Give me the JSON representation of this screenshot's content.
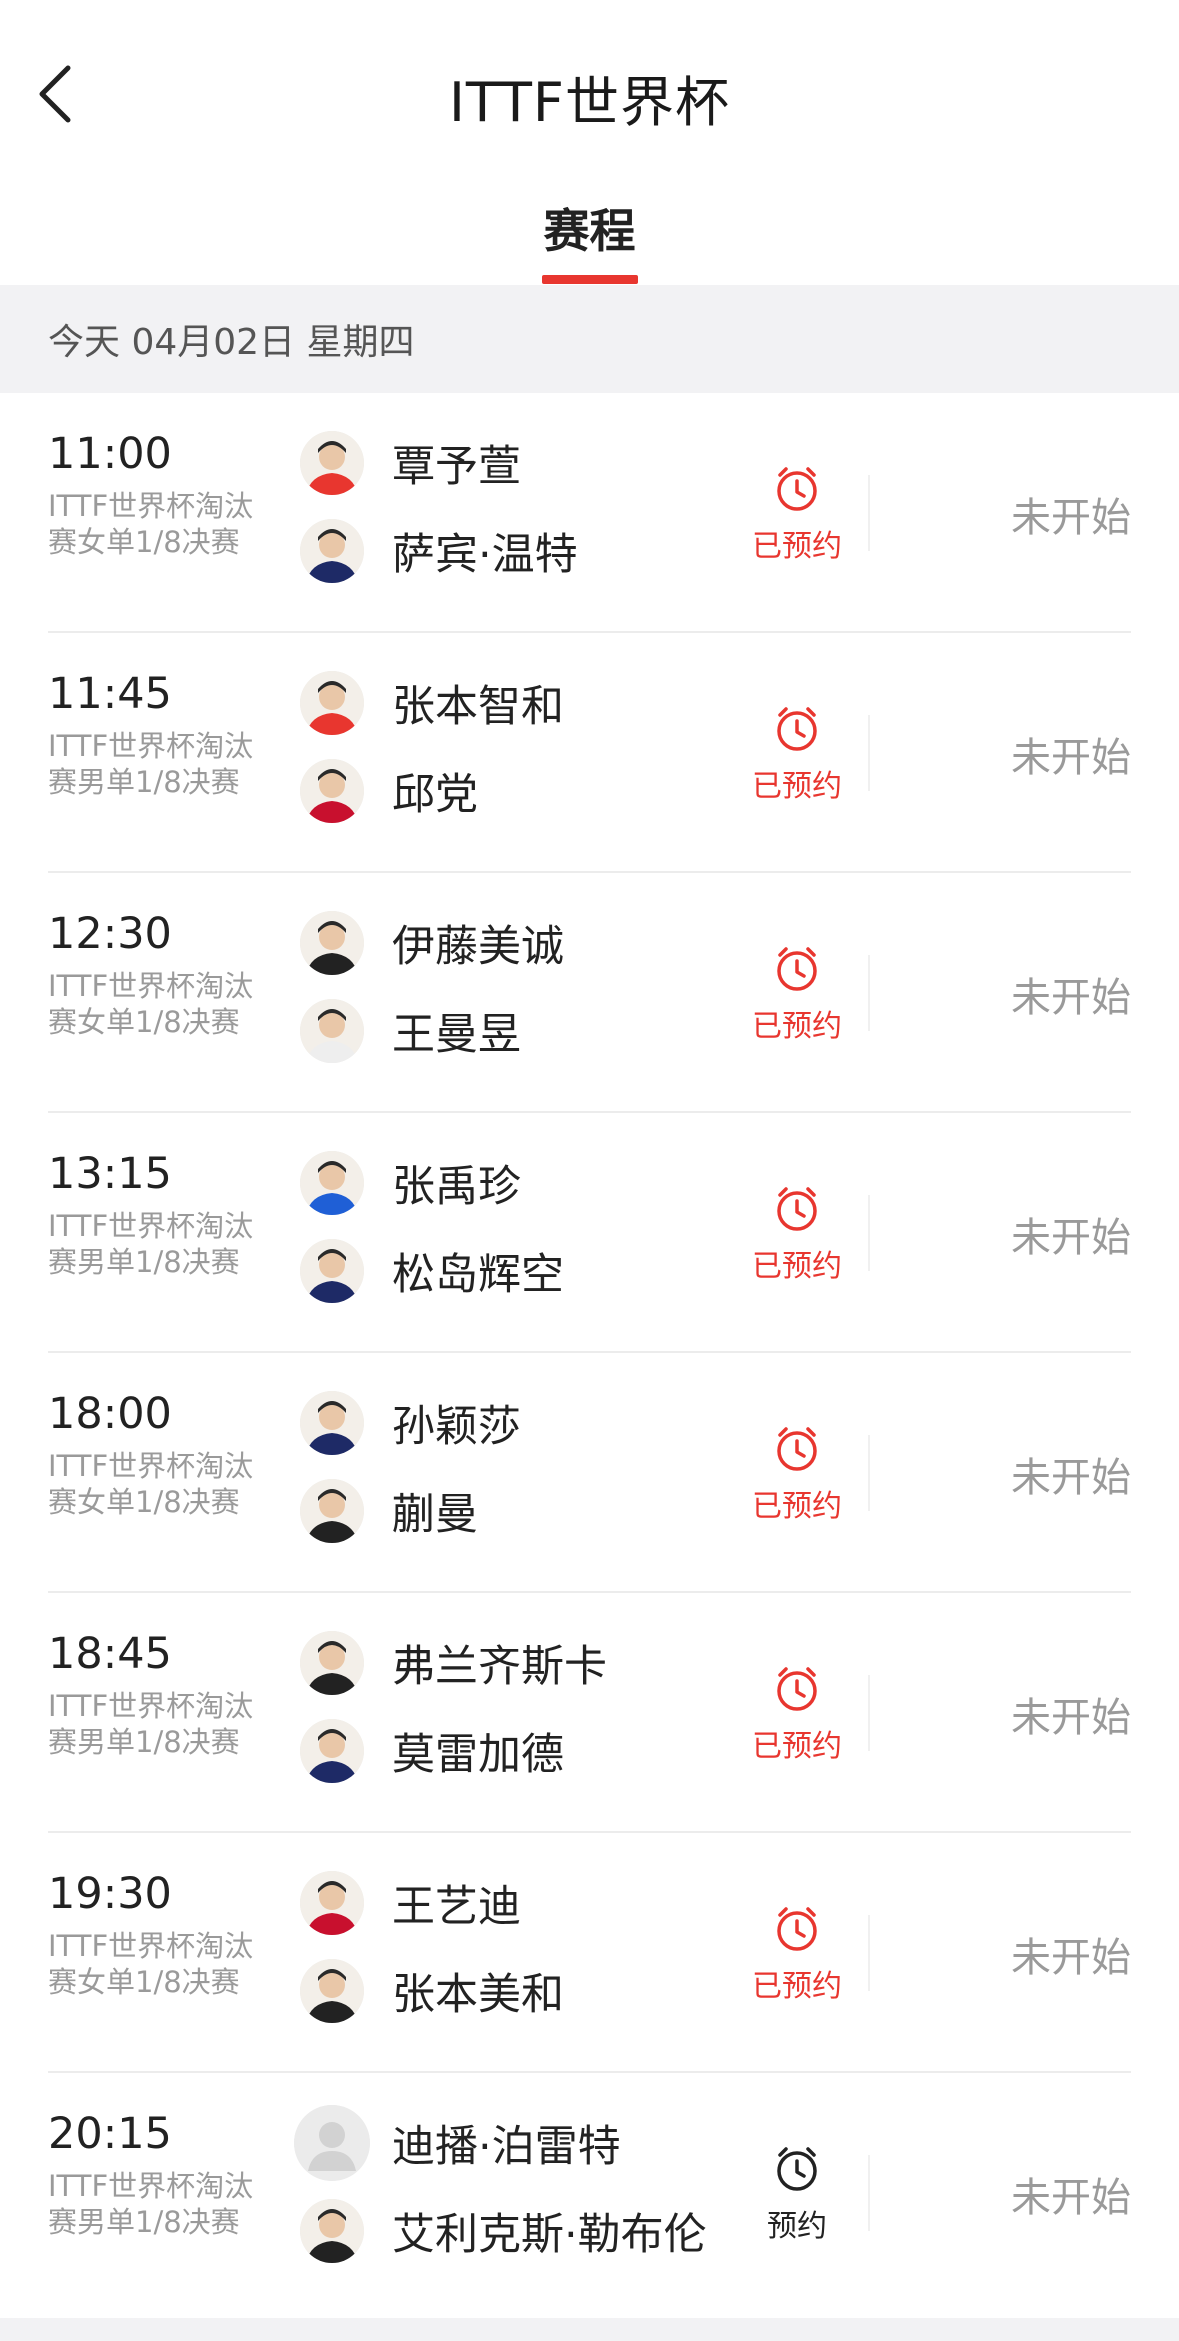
{
  "header": {
    "title": "ITTF世界杯"
  },
  "tabs": [
    {
      "label": "赛程"
    }
  ],
  "date_bar": {
    "text": "今天 04月02日 星期四"
  },
  "matches": [
    {
      "time": "11:00",
      "desc": "ITTF世界杯淘汰赛女单1/8决赛",
      "player1": "覃予萱",
      "player2": "萨宾·温特",
      "reserve": "已预约",
      "status": "未开始"
    },
    {
      "time": "11:45",
      "desc": "ITTF世界杯淘汰赛男单1/8决赛",
      "player1": "张本智和",
      "player2": "邱党",
      "reserve": "已预约",
      "status": "未开始"
    },
    {
      "time": "12:30",
      "desc": "ITTF世界杯淘汰赛女单1/8决赛",
      "player1": "伊藤美诚",
      "player2": "王曼昱",
      "reserve": "已预约",
      "status": "未开始"
    },
    {
      "time": "13:15",
      "desc": "ITTF世界杯淘汰赛男单1/8决赛",
      "player1": "张禹珍",
      "player2": "松岛辉空",
      "reserve": "已预约",
      "status": "未开始"
    },
    {
      "time": "18:00",
      "desc": "ITTF世界杯淘汰赛女单1/8决赛",
      "player1": "孙颖莎",
      "player2": "蒯曼",
      "reserve": "已预约",
      "status": "未开始"
    },
    {
      "time": "18:45",
      "desc": "ITTF世界杯淘汰赛男单1/8决赛",
      "player1": "弗兰齐斯卡",
      "player2": "莫雷加德",
      "reserve": "已预约",
      "status": "未开始"
    },
    {
      "time": "19:30",
      "desc": "ITTF世界杯淘汰赛女单1/8决赛",
      "player1": "王艺迪",
      "player2": "张本美和",
      "reserve": "已预约",
      "status": "未开始"
    },
    {
      "time": "20:15",
      "desc": "ITTF世界杯淘汰赛男单1/8决赛",
      "player1": "迪播·泊雷特",
      "player2": "艾利克斯·勒布伦",
      "reserve": "预约",
      "status": "未开始"
    }
  ],
  "colors": {
    "accent": "#e8362f",
    "muted": "#9a9a9a",
    "date_bar_bg": "#f2f2f4"
  },
  "icons": {
    "back": "chevron-left-icon",
    "alarm": "alarm-clock-icon",
    "avatar_placeholder": "person-silhouette-icon"
  }
}
